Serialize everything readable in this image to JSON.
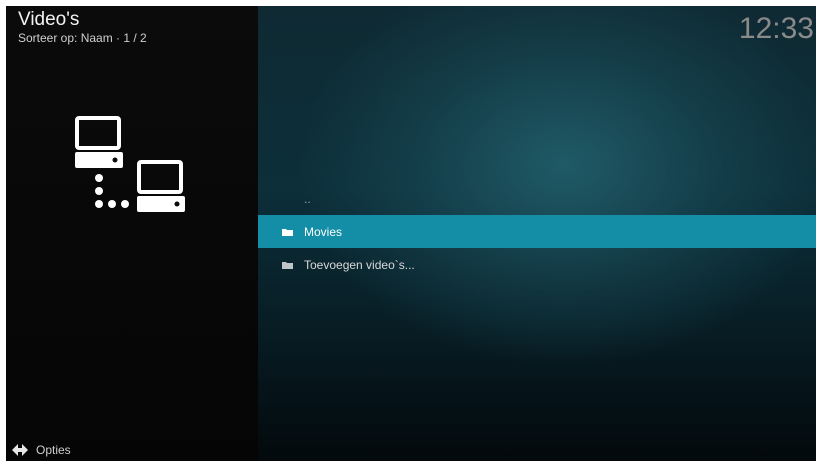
{
  "header": {
    "title": "Video's",
    "subtitle": "Sorteer op: Naam  ·  1 / 2"
  },
  "clock": "12:33",
  "left_panel": {
    "icon": "network-computers-icon"
  },
  "list": {
    "parent_label": "..",
    "items": [
      {
        "label": "Movies",
        "icon": "folder-icon",
        "selected": true
      },
      {
        "label": "Toevoegen video`s...",
        "icon": "folder-icon",
        "selected": false
      }
    ]
  },
  "footer": {
    "options_label": "Opties",
    "icon": "options-arrows-icon"
  },
  "colors": {
    "highlight": "#138ea6",
    "background_accent": "#1f5a66"
  }
}
